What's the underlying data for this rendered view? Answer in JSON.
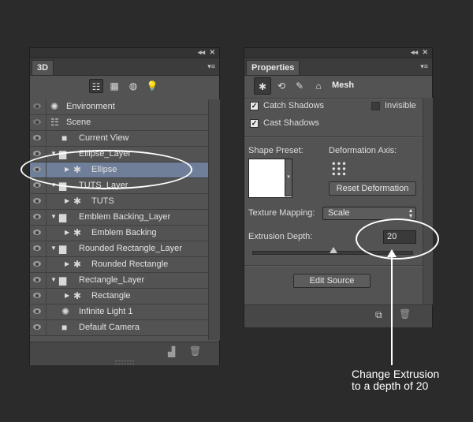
{
  "panel3d": {
    "tab": "3D",
    "layers": [
      {
        "label": "Environment",
        "icon": "✺",
        "icon_name": "environment-icon",
        "depth": 0,
        "expand": "",
        "selected": false
      },
      {
        "label": "Scene",
        "icon": "☷",
        "icon_name": "scene-icon",
        "depth": 0,
        "expand": "",
        "selected": false
      },
      {
        "label": "Current View",
        "icon": "■",
        "icon_name": "camera-icon",
        "depth": 1,
        "expand": "",
        "selected": false
      },
      {
        "label": "Ellipse_Layer",
        "icon": "▆",
        "icon_name": "folder-icon",
        "depth": 0,
        "expand": "▼",
        "selected": false
      },
      {
        "label": "Ellipse",
        "icon": "✱",
        "icon_name": "mesh-icon",
        "depth": 2,
        "expand": "▶",
        "selected": true
      },
      {
        "label": "TUTS_Layer",
        "icon": "▆",
        "icon_name": "folder-icon",
        "depth": 0,
        "expand": "▼",
        "selected": false
      },
      {
        "label": "TUTS",
        "icon": "✱",
        "icon_name": "mesh-icon",
        "depth": 2,
        "expand": "▶",
        "selected": false
      },
      {
        "label": "Emblem Backing_Layer",
        "icon": "▆",
        "icon_name": "folder-icon",
        "depth": 0,
        "expand": "▼",
        "selected": false
      },
      {
        "label": "Emblem Backing",
        "icon": "✱",
        "icon_name": "mesh-icon",
        "depth": 2,
        "expand": "▶",
        "selected": false
      },
      {
        "label": "Rounded Rectangle_Layer",
        "icon": "▆",
        "icon_name": "folder-icon",
        "depth": 0,
        "expand": "▼",
        "selected": false
      },
      {
        "label": "Rounded Rectangle",
        "icon": "✱",
        "icon_name": "mesh-icon",
        "depth": 2,
        "expand": "▶",
        "selected": false
      },
      {
        "label": "Rectangle_Layer",
        "icon": "▆",
        "icon_name": "folder-icon",
        "depth": 0,
        "expand": "▼",
        "selected": false
      },
      {
        "label": "Rectangle",
        "icon": "✱",
        "icon_name": "mesh-icon",
        "depth": 2,
        "expand": "▶",
        "selected": false
      },
      {
        "label": "Infinite Light 1",
        "icon": "✺",
        "icon_name": "light-icon",
        "depth": 1,
        "expand": "",
        "selected": false
      },
      {
        "label": "Default Camera",
        "icon": "■",
        "icon_name": "camera-icon",
        "depth": 1,
        "expand": "",
        "selected": false
      }
    ]
  },
  "properties": {
    "tab": "Properties",
    "mode_label": "Mesh",
    "catch_shadows": "Catch Shadows",
    "cast_shadows": "Cast Shadows",
    "invisible": "Invisible",
    "shape_preset": "Shape Preset:",
    "deformation_axis": "Deformation Axis:",
    "reset_deformation": "Reset Deformation",
    "texture_mapping": "Texture Mapping:",
    "texture_mapping_value": "Scale",
    "extrusion_depth": "Extrusion Depth:",
    "extrusion_value": "20",
    "edit_source": "Edit Source"
  },
  "annotation": {
    "line1": "Change Extrusion",
    "line2": "to a depth of 20"
  }
}
